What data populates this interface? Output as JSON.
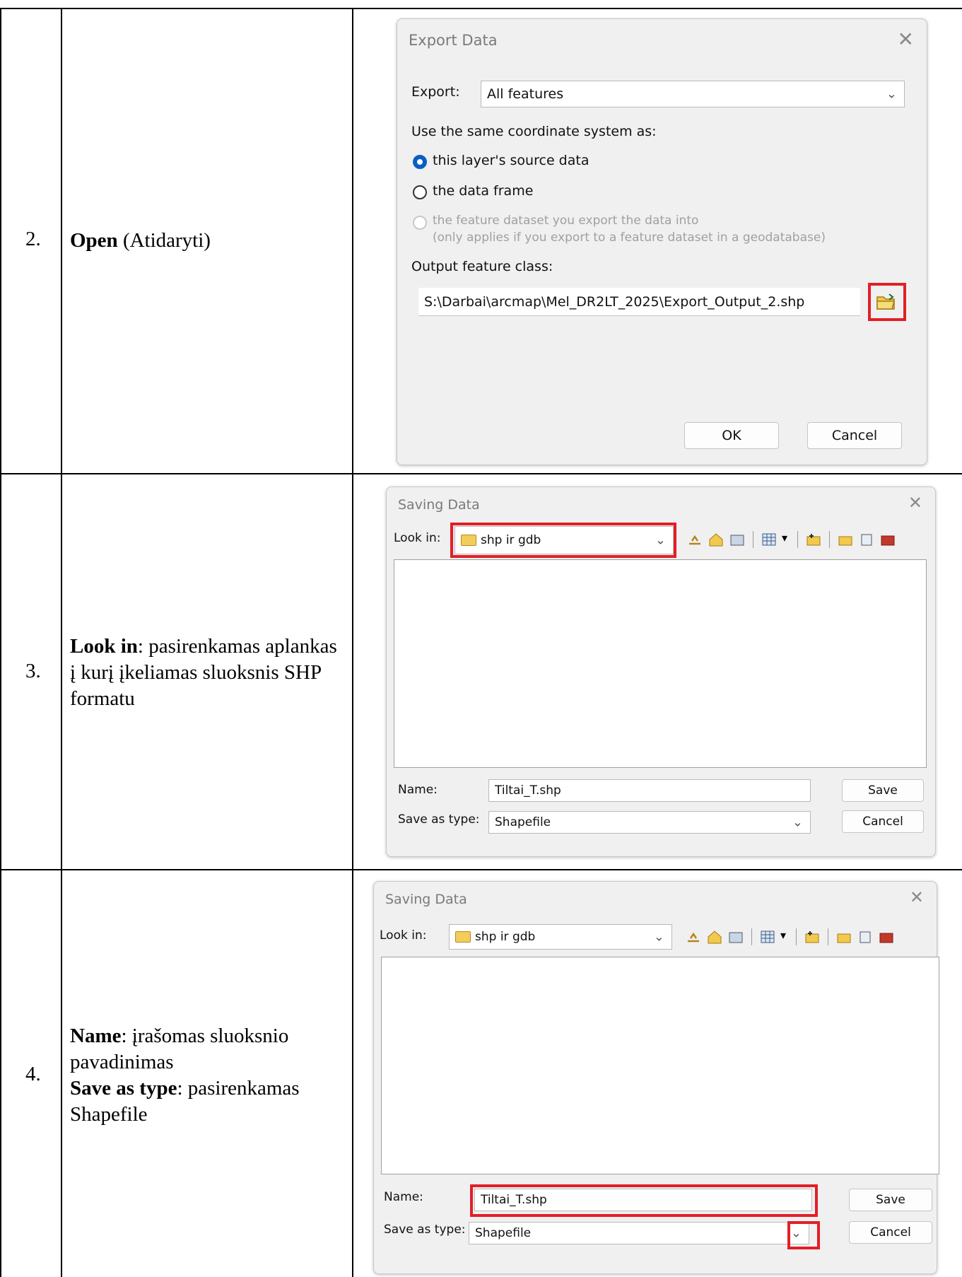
{
  "rows": [
    {
      "num": "2.",
      "bold": "Open",
      "rest": " (Atidaryti)"
    },
    {
      "num": "3.",
      "bold": "Look in",
      "rest": ": pasirenkamas aplankas į kurį įkeliamas sluoksnis SHP formatu"
    },
    {
      "num": "4.",
      "bold1": "Name",
      "rest1": ": įrašomas sluoksnio pavadinimas",
      "bold2": "Save as type",
      "rest2": ": pasirenkamas Shapefile"
    }
  ],
  "export_dialog": {
    "title": "Export Data",
    "export_label": "Export:",
    "export_value": "All features",
    "coord_label": "Use the same coordinate system as:",
    "opt1": "this layer's source data",
    "opt2": "the data frame",
    "opt3": "the feature dataset you export the data into",
    "opt3_note": "(only applies if you export to a feature dataset in a geodatabase)",
    "output_label": "Output feature class:",
    "output_value": "S:\\Darbai\\arcmap\\Mel_DR2LT_2025\\Export_Output_2.shp",
    "ok": "OK",
    "cancel": "Cancel"
  },
  "saving_dialog": {
    "title": "Saving Data",
    "look_in_label": "Look in:",
    "look_in_value": "shp ir gdb",
    "name_label": "Name:",
    "name_value": "Tiltai_T.shp",
    "type_label": "Save as type:",
    "type_value": "Shapefile",
    "save": "Save",
    "cancel": "Cancel"
  },
  "colors": {
    "highlight": "#e21f26",
    "radio": "#0a5fc2"
  }
}
